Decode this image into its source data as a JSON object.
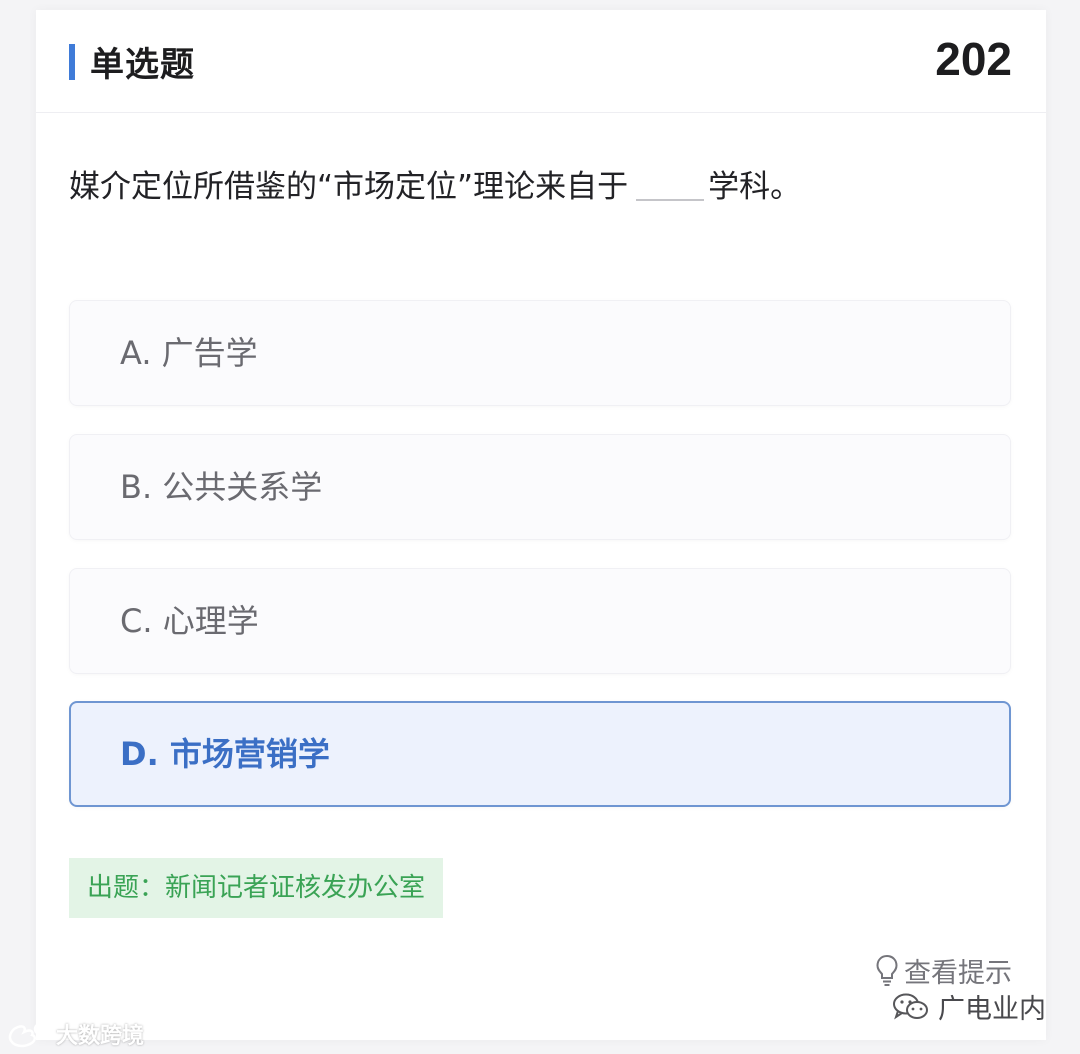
{
  "header": {
    "title": "单选题",
    "number": "202",
    "accent_color": "#3f7bd8"
  },
  "question": {
    "text_before": "媒介定位所借鉴的“市场定位”理论来自于",
    "text_after": "学科。"
  },
  "options": [
    {
      "text": "A. 广告学",
      "selected": false
    },
    {
      "text": "B. 公共关系学",
      "selected": false
    },
    {
      "text": "C. 心理学",
      "selected": false
    },
    {
      "text": "D. 市场营销学",
      "selected": true
    }
  ],
  "source_tag": {
    "text": "出题：新闻记者证核发办公室",
    "color": "#3aa355"
  },
  "hint": {
    "icon": "lightbulb-icon",
    "label": "查看提示"
  },
  "watermarks": {
    "wechat_icon": "wechat-icon",
    "wechat_account": "广电业内",
    "weibo_icon": "weibo-icon",
    "weibo_account": "大数跨境"
  }
}
